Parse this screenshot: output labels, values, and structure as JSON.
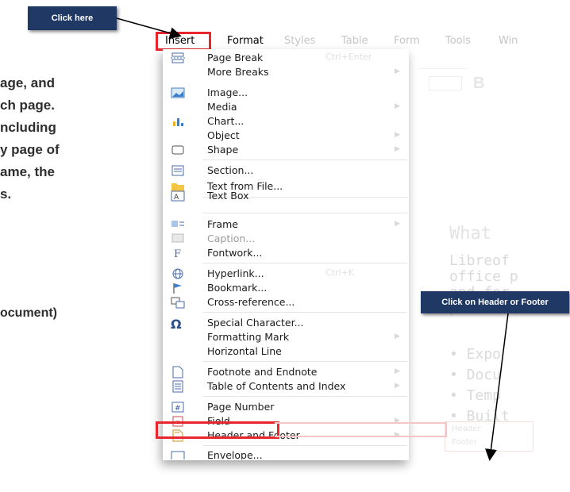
{
  "callouts": {
    "click_here": "Click here",
    "click_header_footer": "Click on Header or Footer"
  },
  "document": {
    "lines": [
      "age, and",
      "ch page.",
      "ncluding",
      "y page of",
      "ame, the",
      "s."
    ],
    "footer_line": "ocument)",
    "right_heading": "What",
    "right_lines": [
      "Libreof",
      "office p",
      "and for",
      "provid"
    ],
    "right_bullets": [
      "• Expo",
      "• Docu",
      "• Temp",
      "• Built"
    ]
  },
  "menubar": {
    "items": [
      "Insert",
      "Format",
      "Styles",
      "Table",
      "Form",
      "Tools",
      "Win"
    ]
  },
  "menu": {
    "items": [
      {
        "label": "Page Break",
        "shortcut": "Ctrl+Enter",
        "icon": "page-break-icon"
      },
      {
        "label": "More Breaks",
        "arrow": true
      },
      {
        "label": "Image...",
        "icon": "image-icon"
      },
      {
        "label": "Media",
        "arrow": true
      },
      {
        "label": "Chart...",
        "icon": "chart-icon"
      },
      {
        "label": "Object",
        "arrow": true
      },
      {
        "label": "Shape",
        "icon": "shape-icon",
        "arrow": true
      },
      {
        "label": "Section...",
        "icon": "section-icon"
      },
      {
        "label": "Text from File...",
        "icon": "folder-icon"
      },
      {
        "label": "Text Box",
        "icon": "text-box-icon"
      },
      {
        "label": "Frame",
        "icon": "frame-icon",
        "arrow": true
      },
      {
        "label": "Caption...",
        "icon": "caption-icon"
      },
      {
        "label": "Fontwork...",
        "icon": "fontwork-icon"
      },
      {
        "label": "Hyperlink...",
        "shortcut": "Ctrl+K",
        "icon": "hyperlink-icon"
      },
      {
        "label": "Bookmark...",
        "icon": "bookmark-icon"
      },
      {
        "label": "Cross-reference...",
        "icon": "cross-reference-icon"
      },
      {
        "label": "Special Character...",
        "icon": "special-character-icon"
      },
      {
        "label": "Formatting Mark",
        "arrow": true
      },
      {
        "label": "Horizontal Line"
      },
      {
        "label": "Footnote and Endnote",
        "icon": "footnote-icon",
        "arrow": true
      },
      {
        "label": "Table of Contents and Index",
        "icon": "toc-icon",
        "arrow": true
      },
      {
        "label": "Page Number",
        "icon": "page-number-icon"
      },
      {
        "label": "Field",
        "icon": "field-icon",
        "arrow": true
      },
      {
        "label": "Header and Footer",
        "icon": "header-footer-icon",
        "arrow": true
      },
      {
        "label": "Envelope...",
        "icon": "envelope-icon"
      }
    ],
    "submenu": [
      "Header",
      "Footer"
    ]
  },
  "colors": {
    "callout_bg": "#1f3864",
    "highlight": "#e8262e"
  }
}
